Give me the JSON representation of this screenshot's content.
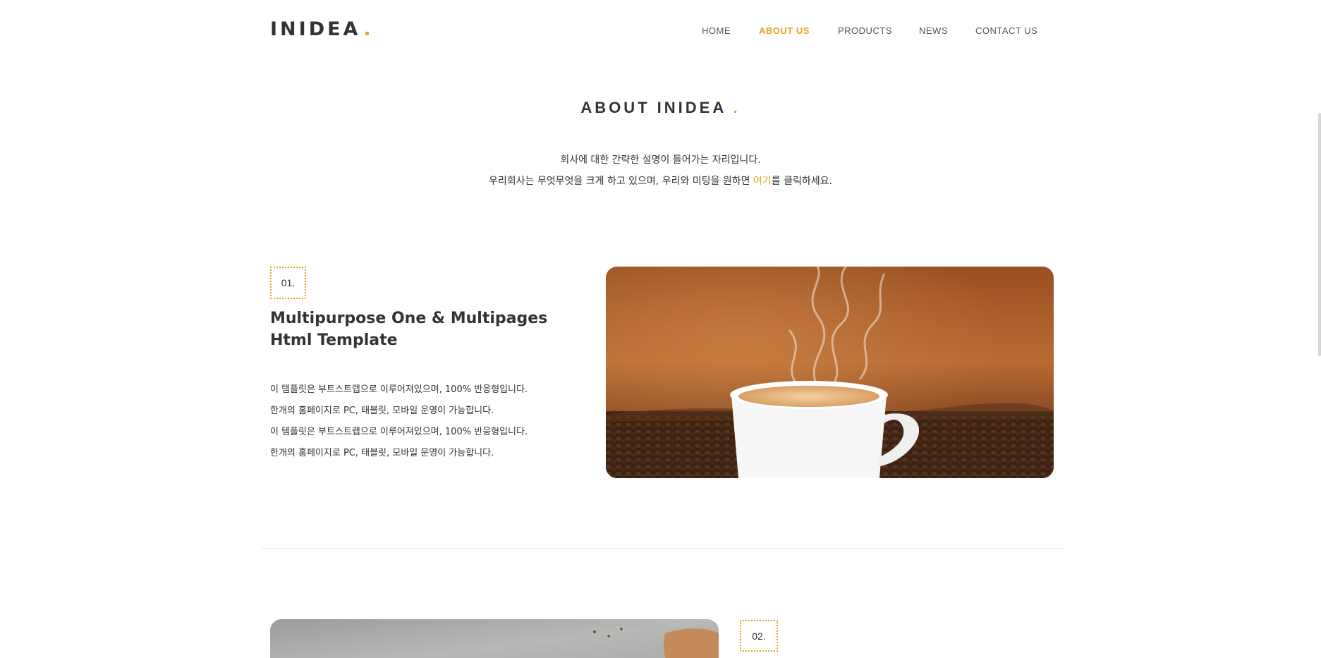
{
  "header": {
    "logo_text": "INIDEA",
    "logo_dot": ".",
    "nav": [
      {
        "label": "HOME",
        "active": false
      },
      {
        "label": "ABOUT US",
        "active": true
      },
      {
        "label": "PRODUCTS",
        "active": false
      },
      {
        "label": "NEWS",
        "active": false
      },
      {
        "label": "CONTACT US",
        "active": false
      }
    ]
  },
  "about": {
    "title": "ABOUT INIDEA",
    "title_dot": ".",
    "line1": "회사에 대한 간략한 설명이 들어가는 자리입니다.",
    "line2_before": "우리회사는 무엇무엇을 크게 하고 있으며, 우리와 미팅을 원하면 ",
    "line2_link": "여기",
    "line2_after": "를 클릭하세요."
  },
  "features": [
    {
      "number": "01.",
      "title": "Multipurpose One & Multipages Html Template",
      "lines": [
        "이 템플릿은 부트스트랩으로 이루어져있으며, 100% 반응형입니다.",
        "한개의 홈페이지로 PC, 태블릿, 모바일 운영이 가능합니다.",
        "이 템플릿은 부트스트랩으로 이루어져있으며, 100% 반응형입니다.",
        "한개의 홈페이지로 PC, 태블릿, 모바일 운영이 가능합니다."
      ]
    },
    {
      "number": "02."
    }
  ],
  "colors": {
    "accent": "#e8a321",
    "text": "#333333"
  }
}
